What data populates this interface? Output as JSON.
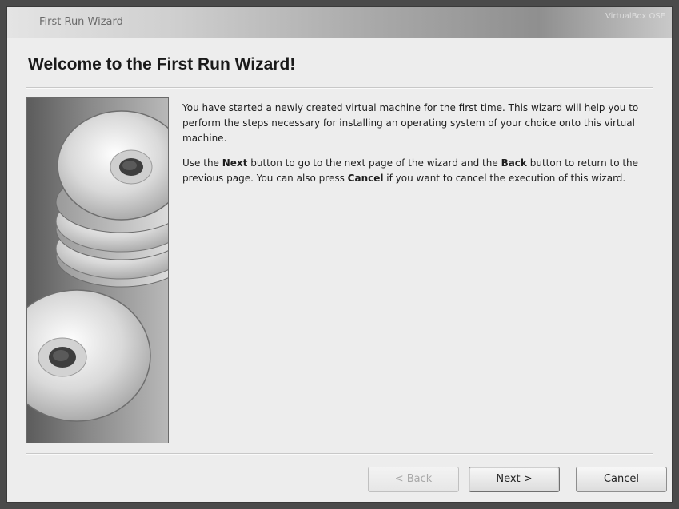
{
  "window": {
    "title": "First Run Wizard",
    "title_right": "VirtualBox OSE"
  },
  "page": {
    "heading": "Welcome to the First Run Wizard!",
    "paragraph1": "You have started a newly created virtual machine for the first time. This wizard will help you to perform the steps necessary for installing an operating system of your choice onto this virtual machine.",
    "paragraph2": {
      "part1": "Use the ",
      "next_word": "Next",
      "part2": " button to go to the next page of the wizard and the ",
      "back_word": "Back",
      "part3": " button to return to the previous page. You can also press ",
      "cancel_word": "Cancel",
      "part4": " if you want to cancel the execution of this wizard."
    }
  },
  "buttons": {
    "back": "< Back",
    "next": "Next >",
    "cancel": "Cancel"
  },
  "icons": {
    "side_art": "stacked-cds-illustration"
  }
}
